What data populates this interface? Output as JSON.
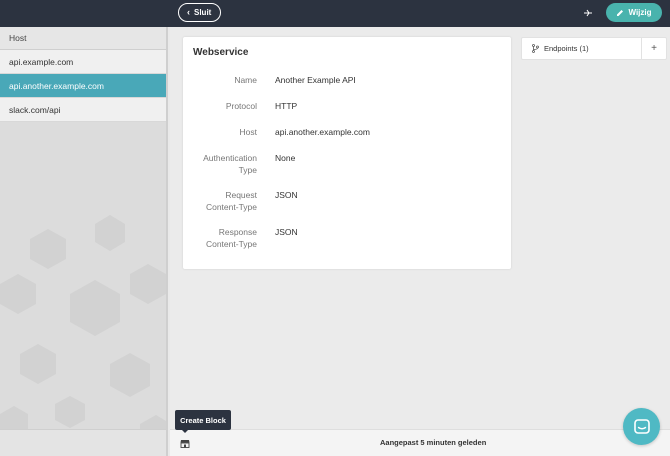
{
  "topbar": {
    "close_label": "Sluit",
    "edit_label": "Wijzig",
    "colors": {
      "bar": "#2c3340",
      "accent": "#49b3ad"
    }
  },
  "sidebar": {
    "header": "Host",
    "items": [
      {
        "label": "api.example.com",
        "active": false
      },
      {
        "label": "api.another.example.com",
        "active": true
      },
      {
        "label": "slack.com/api",
        "active": false
      }
    ],
    "active_color": "#49a8b8"
  },
  "card": {
    "title": "Webservice",
    "fields": [
      {
        "label": "Name",
        "value": "Another Example API"
      },
      {
        "label": "Protocol",
        "value": "HTTP"
      },
      {
        "label": "Host",
        "value": "api.another.example.com"
      },
      {
        "label_lines": [
          "Authentication",
          "Type"
        ],
        "value": "None"
      },
      {
        "label_lines": [
          "Request",
          "Content-Type"
        ],
        "value": "JSON"
      },
      {
        "label_lines": [
          "Response",
          "Content-Type"
        ],
        "value": "JSON"
      }
    ]
  },
  "endpoints": {
    "label": "Endpoints (1)",
    "add_icon": "plus-icon",
    "branch_icon": "branch-icon"
  },
  "footer": {
    "status": "Aangepast 5 minuten geleden",
    "tooltip": "Create Block",
    "block_icon": "store-icon"
  },
  "chat": {
    "icon": "chat-icon"
  }
}
